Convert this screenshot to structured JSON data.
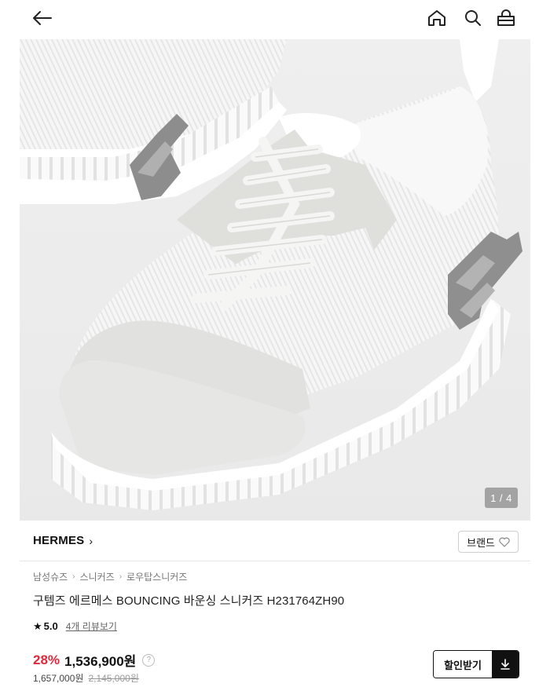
{
  "header": {
    "icons": [
      "back-arrow-icon",
      "home-icon",
      "search-icon",
      "shopping-bag-icon"
    ]
  },
  "gallery": {
    "counter": "1 / 4"
  },
  "brand": {
    "name": "HERMES",
    "chevron": "›",
    "button_label": "브랜드"
  },
  "breadcrumb": {
    "items": [
      "남성슈즈",
      "스니커즈",
      "로우탑스니커즈"
    ],
    "separator": "›"
  },
  "product": {
    "title": "구템즈 에르메스 BOUNCING 바운싱 스니커즈 H231764ZH90",
    "rating_star": "★",
    "rating": "5.0",
    "review_link": "4개 리뷰보기",
    "discount": "28%",
    "price": "1,536,900원",
    "help": "?",
    "sub_price": "1,657,000원",
    "original_price": "2,145,000원"
  },
  "coupon": {
    "label": "할인받기"
  },
  "colors": {
    "discount": "#e0283c",
    "background": "#ffffff",
    "hero_bg": "#eeeeee"
  }
}
